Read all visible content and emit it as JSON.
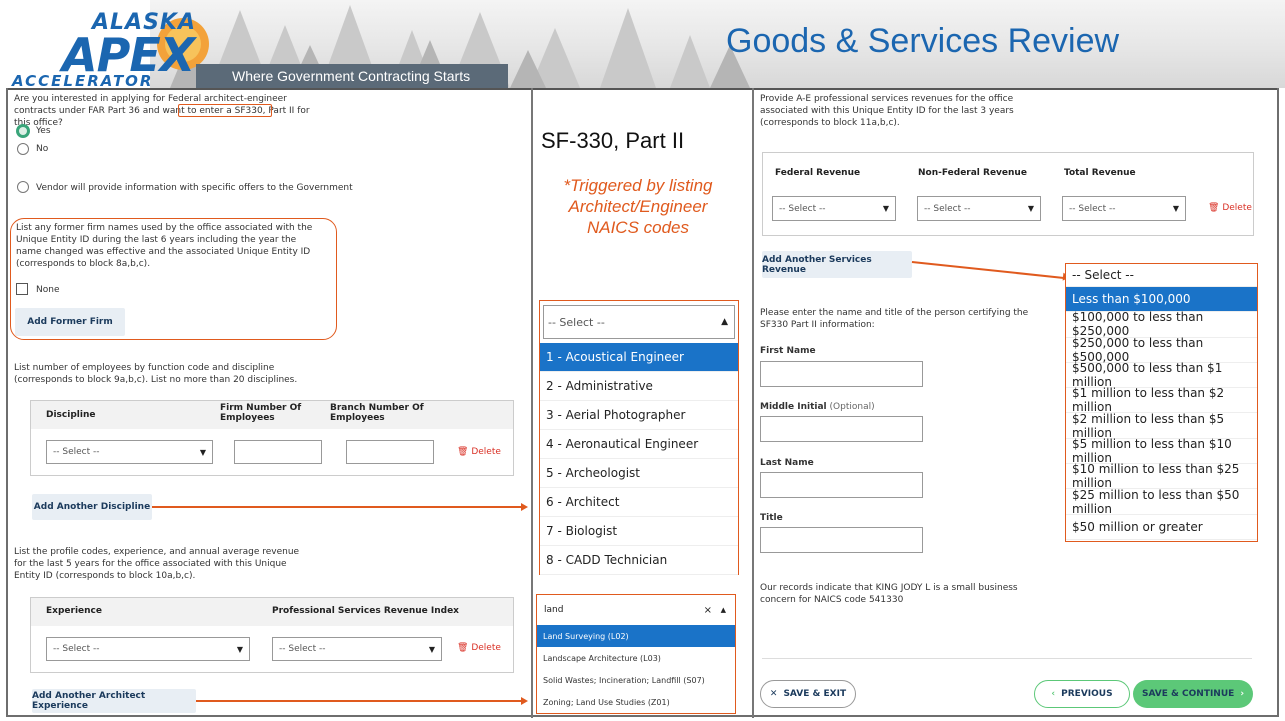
{
  "header": {
    "logo_alaska": "ALASKA",
    "logo_apex": "APEX",
    "logo_accelerator": "ACCELERATOR",
    "tagline": "Where Government Contracting Starts",
    "title": "Goods & Services Review"
  },
  "left": {
    "q_federal": "Are you interested in applying for Federal architect-engineer contracts under FAR Part 36 and want to enter a SF330, Part II for this office?",
    "radio_yes": "Yes",
    "radio_no": "No",
    "radio_vendor": "Vendor will provide information with specific offers to the Government",
    "former_firm_text": "List any former firm names used by the office associated with the Unique Entity ID during the last 6 years including the year the name changed was effective and the associated Unique Entity ID (corresponds to block 8a,b,c).",
    "none_label": "None",
    "add_former_firm": "Add Former Firm",
    "employees_text": "List number of employees by function code and discipline (corresponds to block 9a,b,c). List no more than 20 disciplines.",
    "col_discipline": "Discipline",
    "col_firm_emp": "Firm Number Of Employees",
    "col_branch_emp": "Branch Number Of Employees",
    "select_placeholder": "-- Select --",
    "delete_label": "Delete",
    "add_discipline": "Add Another Discipline",
    "profile_text": "List the profile codes, experience, and annual average revenue for the last 5 years for the office associated with this Unique Entity ID (corresponds to block 10a,b,c).",
    "col_experience": "Experience",
    "col_psri": "Professional Services Revenue Index",
    "add_arch_exp": "Add Another Architect Experience"
  },
  "middle": {
    "heading": "SF-330, Part II",
    "note": "*Triggered by listing Architect/Engineer NAICS codes",
    "discipline_dd_placeholder": "-- Select --",
    "discipline_options": [
      "1 - Acoustical Engineer",
      "2 - Administrative",
      "3 - Aerial Photographer",
      "4 - Aeronautical Engineer",
      "5 - Archeologist",
      "6 - Architect",
      "7 - Biologist",
      "8 - CADD Technician"
    ],
    "search_value": "land",
    "search_clear": "×",
    "experience_options": [
      "Land Surveying (L02)",
      "Landscape Architecture (L03)",
      "Solid Wastes; Incineration; Landfill (S07)",
      "Zoning; Land Use Studies (Z01)"
    ]
  },
  "right": {
    "revenue_text": "Provide A-E professional services revenues for the office associated with this Unique Entity ID for the last 3 years (corresponds to block 11a,b,c).",
    "col_federal": "Federal Revenue",
    "col_nonfederal": "Non-Federal Revenue",
    "col_total": "Total Revenue",
    "select_placeholder": "-- Select --",
    "delete_label": "Delete",
    "add_services_revenue": "Add Another Services Revenue",
    "certify_text": "Please enter the name and title of the person certifying the SF330 Part II information:",
    "first_name": "First Name",
    "middle_initial": "Middle Initial",
    "optional": "(Optional)",
    "last_name": "Last Name",
    "title_label": "Title",
    "records_text": "Our records indicate that KING JODY L is a small business concern for NAICS code 541330",
    "save_exit": "SAVE & EXIT",
    "previous": "PREVIOUS",
    "save_continue": "SAVE & CONTINUE",
    "revenue_dd_placeholder": "-- Select --",
    "revenue_options": [
      "Less than $100,000",
      "$100,000 to less than $250,000",
      "$250,000 to less than $500,000",
      "$500,000 to less than $1 million",
      "$1 million to less than $2 million",
      "$2 million to less than $5 million",
      "$5 million to less than $10 million",
      "$10 million to less than $25 million",
      "$25 million to less than $50 million",
      "$50 million or greater"
    ]
  },
  "colors": {
    "brand_blue": "#1b66b0",
    "annotation_orange": "#e05a1e",
    "highlight_blue": "#1a73c8",
    "success_green": "#5cc878",
    "danger_red": "#d93025"
  }
}
